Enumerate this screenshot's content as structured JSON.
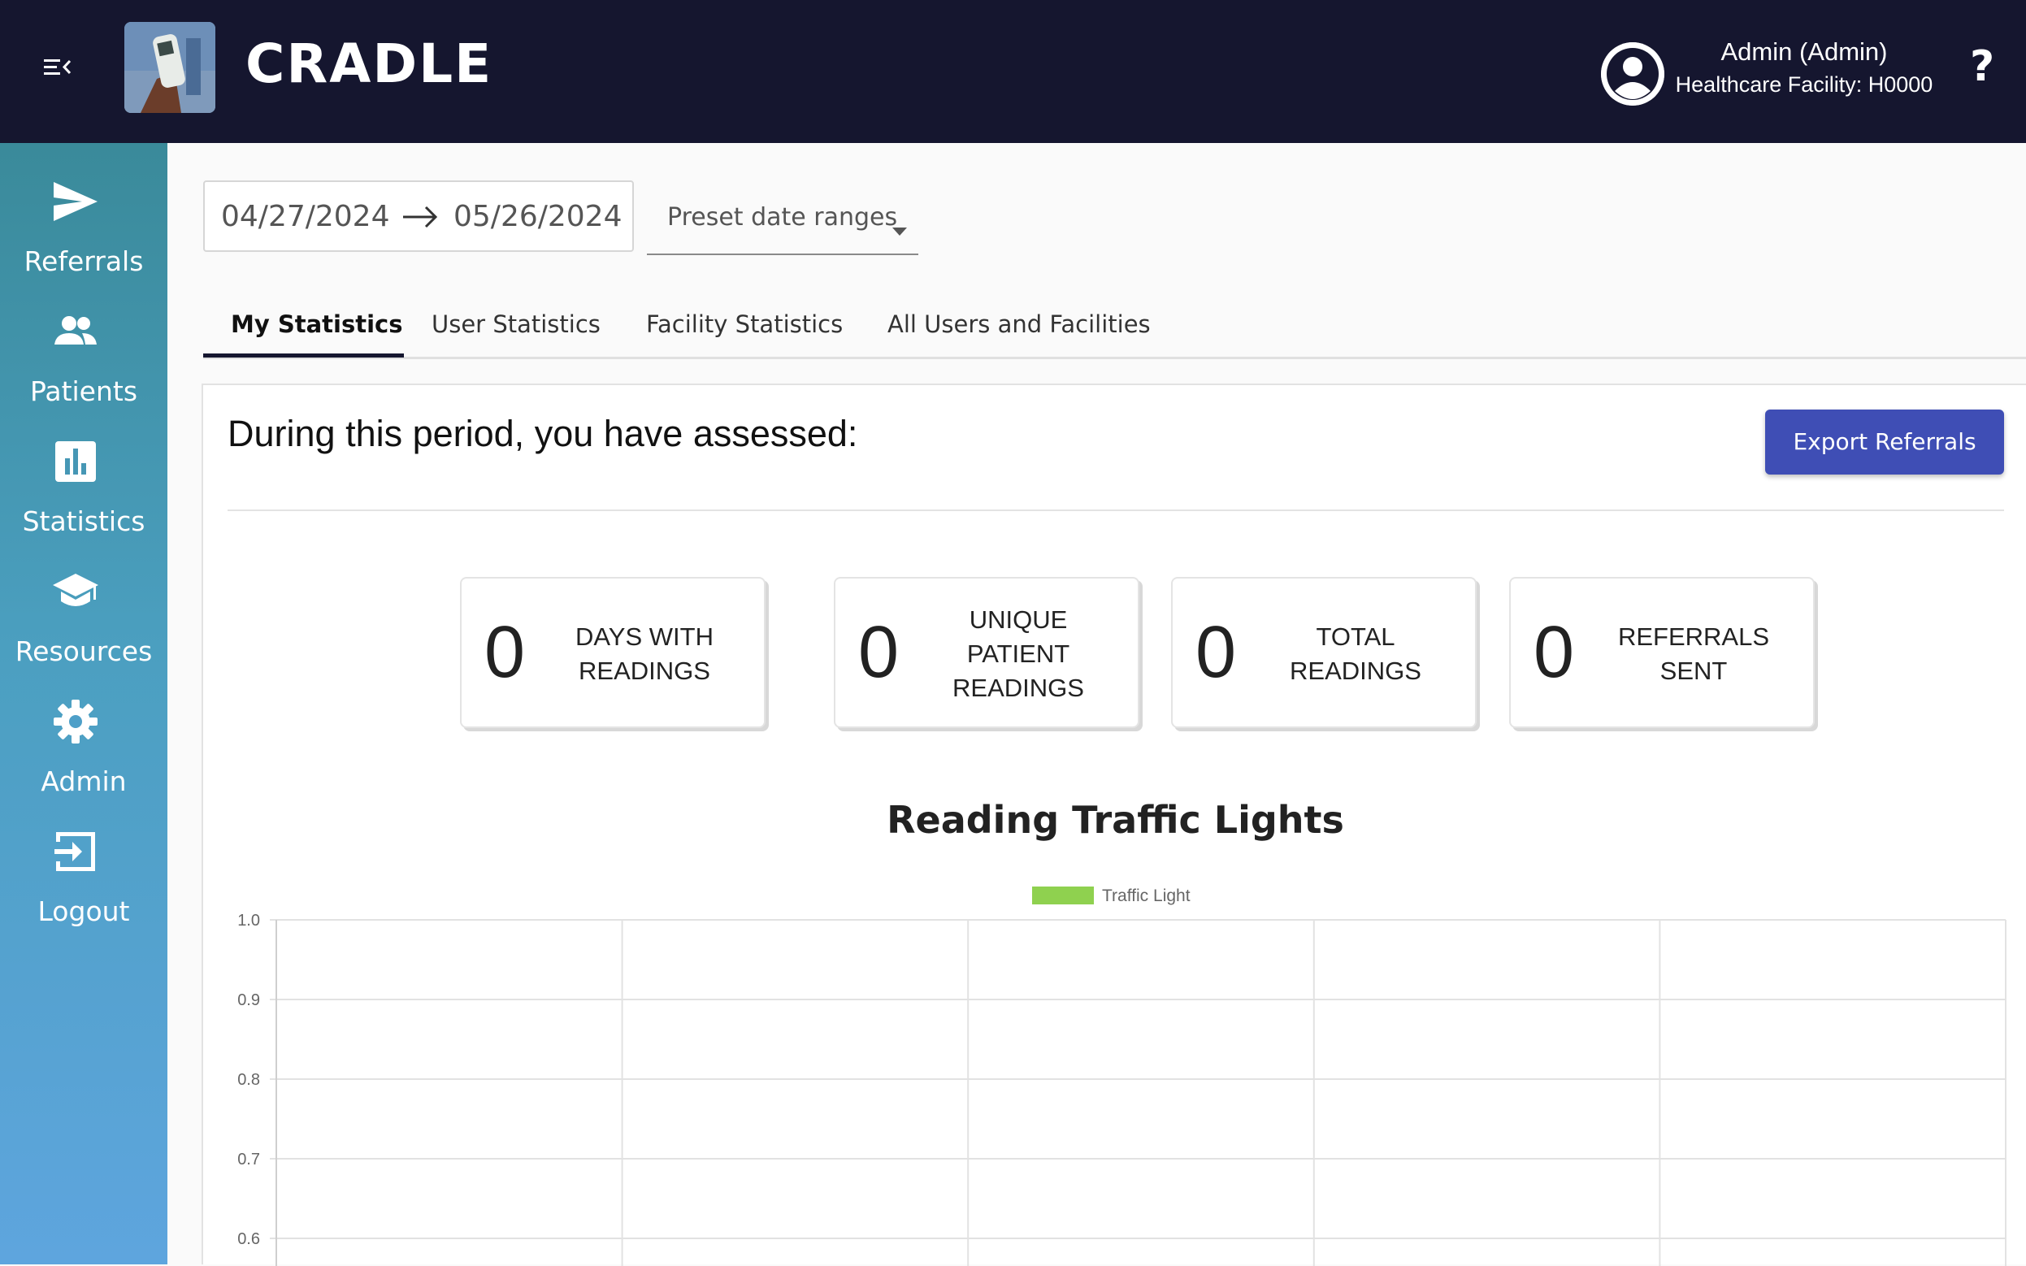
{
  "header": {
    "brand": "CRADLE",
    "user_name": "Admin (Admin)",
    "user_facility": "Healthcare Facility: H0000",
    "help": "?"
  },
  "sidebar": {
    "items": [
      {
        "label": "Referrals",
        "icon": "send-icon"
      },
      {
        "label": "Patients",
        "icon": "people-icon"
      },
      {
        "label": "Statistics",
        "icon": "bar-chart-icon"
      },
      {
        "label": "Resources",
        "icon": "school-icon"
      },
      {
        "label": "Admin",
        "icon": "gear-icon"
      },
      {
        "label": "Logout",
        "icon": "logout-icon"
      }
    ]
  },
  "filters": {
    "date_start": "04/27/2024",
    "date_end": "05/26/2024",
    "preset_label": "Preset date ranges"
  },
  "tabs": [
    {
      "label": "My Statistics",
      "active": true
    },
    {
      "label": "User Statistics",
      "active": false
    },
    {
      "label": "Facility Statistics",
      "active": false
    },
    {
      "label": "All Users and Facilities",
      "active": false
    }
  ],
  "summary": {
    "heading": "During this period, you have assessed:",
    "export_label": "Export Referrals",
    "stats": [
      {
        "value": "0",
        "label": "DAYS WITH READINGS"
      },
      {
        "value": "0",
        "label": "UNIQUE PATIENT READINGS"
      },
      {
        "value": "0",
        "label": "TOTAL READINGS"
      },
      {
        "value": "0",
        "label": "REFERRALS SENT"
      }
    ]
  },
  "chart_data": {
    "type": "bar",
    "title": "Reading Traffic Lights",
    "categories": [],
    "series": [
      {
        "name": "Traffic Light",
        "values": [],
        "color": "#8fd14f"
      }
    ],
    "ylim": [
      0.6,
      1.0
    ],
    "yticks": [
      "1.0",
      "0.9",
      "0.8",
      "0.7",
      "0.6"
    ],
    "grid": true,
    "legend": "top-center"
  }
}
